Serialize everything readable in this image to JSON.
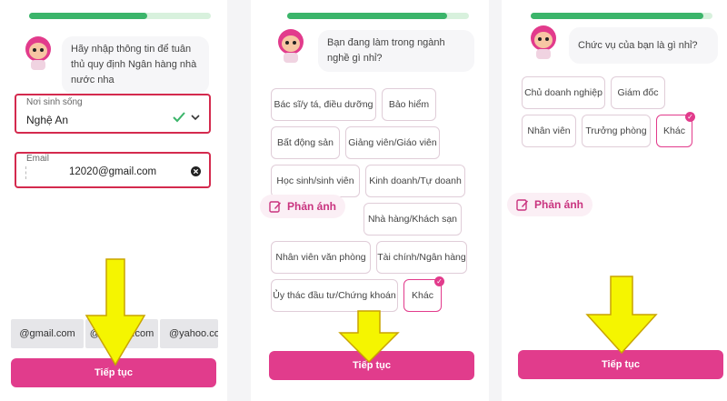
{
  "progress": {
    "screen1": 0.65,
    "screen2": 0.88,
    "screen3": 0.95
  },
  "colors": {
    "accent": "#e13c8c",
    "error_border": "#d42a4e",
    "progress_green": "#3bb56a",
    "arrow_yellow": "#f5f500"
  },
  "screen1": {
    "bot_message": "Hãy nhập thông tin để tuân thủ quy định Ngân hàng nhà nước nha",
    "residence": {
      "label": "Nơi sinh sống",
      "value": "Nghệ An"
    },
    "email": {
      "label": "Email",
      "value": "12020@gmail.com"
    },
    "suggestions": [
      "@gmail.com",
      "@hotmail.com",
      "@yahoo.com"
    ],
    "continue_label": "Tiếp tục"
  },
  "screen2": {
    "bot_message": "Bạn đang làm trong ngành nghề gì nhỉ?",
    "options": [
      "Bác sĩ/y tá, điều dưỡng",
      "Bảo hiểm",
      "Bất động sản",
      "Giảng viên/Giáo viên",
      "Học sinh/sinh viên",
      "Kinh doanh/Tự doanh",
      "Nhà hàng/Khách sạn",
      "Nhân viên văn phòng",
      "Tài chính/Ngân hàng",
      "Ủy thác đầu tư/Chứng khoán",
      "Khác"
    ],
    "selected": "Khác",
    "feedback_label": "Phản ánh",
    "continue_label": "Tiếp tục"
  },
  "screen3": {
    "bot_message": "Chức vụ của bạn là gì nhỉ?",
    "options": [
      "Chủ doanh nghiệp",
      "Giám đốc",
      "Nhân viên",
      "Trưởng phòng",
      "Khác"
    ],
    "selected": "Khác",
    "feedback_label": "Phản ánh",
    "continue_label": "Tiếp tục"
  }
}
